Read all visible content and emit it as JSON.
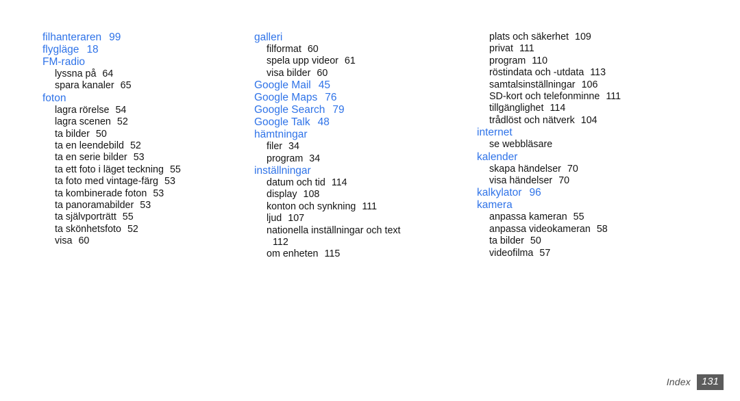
{
  "document": {
    "type": "index",
    "language": "sv",
    "background_color": "#ffffff",
    "heading_color": "#2f73e8",
    "body_color": "#131313",
    "footer_badge_color": "#5c5c5c"
  },
  "footer": {
    "label": "Index",
    "page_number": "131"
  },
  "columns": [
    {
      "id": "column-1",
      "groups": [
        {
          "heading": "filhanteraren",
          "heading_page": "99",
          "items": []
        },
        {
          "heading": "flygläge",
          "heading_page": "18",
          "items": []
        },
        {
          "heading": "FM-radio",
          "heading_page": "",
          "items": [
            {
              "label": "lyssna på",
              "page": "64"
            },
            {
              "label": "spara kanaler",
              "page": "65"
            }
          ]
        },
        {
          "heading": "foton",
          "heading_page": "",
          "items": [
            {
              "label": "lagra rörelse",
              "page": "54"
            },
            {
              "label": "lagra scenen",
              "page": "52"
            },
            {
              "label": "ta bilder",
              "page": "50"
            },
            {
              "label": "ta en leendebild",
              "page": "52"
            },
            {
              "label": "ta en serie bilder",
              "page": "53"
            },
            {
              "label": "ta ett foto i läget teckning",
              "page": "55"
            },
            {
              "label": "ta foto med vintage-färg",
              "page": "53"
            },
            {
              "label": "ta kombinerade foton",
              "page": "53"
            },
            {
              "label": "ta panoramabilder",
              "page": "53"
            },
            {
              "label": "ta självporträtt",
              "page": "55"
            },
            {
              "label": "ta skönhetsfoto",
              "page": "52"
            },
            {
              "label": "visa",
              "page": "60"
            }
          ]
        }
      ]
    },
    {
      "id": "column-2",
      "groups": [
        {
          "heading": "galleri",
          "heading_page": "",
          "items": [
            {
              "label": "filformat",
              "page": "60"
            },
            {
              "label": "spela upp videor",
              "page": "61"
            },
            {
              "label": "visa bilder",
              "page": "60"
            }
          ]
        },
        {
          "heading": "Google Mail",
          "heading_page": "45",
          "items": []
        },
        {
          "heading": "Google Maps",
          "heading_page": "76",
          "items": []
        },
        {
          "heading": "Google Search",
          "heading_page": "79",
          "items": []
        },
        {
          "heading": "Google Talk",
          "heading_page": "48",
          "items": []
        },
        {
          "heading": "hämtningar",
          "heading_page": "",
          "items": [
            {
              "label": "filer",
              "page": "34"
            },
            {
              "label": "program",
              "page": "34"
            }
          ]
        },
        {
          "heading": "inställningar",
          "heading_page": "",
          "items": [
            {
              "label": "datum och tid",
              "page": "114"
            },
            {
              "label": "display",
              "page": "108"
            },
            {
              "label": "konton och synkning",
              "page": "111"
            },
            {
              "label": "ljud",
              "page": "107"
            },
            {
              "label": "nationella inställningar och text",
              "page": "112",
              "wrap": true
            },
            {
              "label": "om enheten",
              "page": "115"
            }
          ]
        }
      ]
    },
    {
      "id": "column-3",
      "groups": [
        {
          "heading": "",
          "heading_page": "",
          "continuation": true,
          "items": [
            {
              "label": "plats och säkerhet",
              "page": "109"
            },
            {
              "label": "privat",
              "page": "111"
            },
            {
              "label": "program",
              "page": "110"
            },
            {
              "label": "röstindata och -utdata",
              "page": "113"
            },
            {
              "label": "samtalsinställningar",
              "page": "106"
            },
            {
              "label": "SD-kort och telefonminne",
              "page": "111"
            },
            {
              "label": "tillgänglighet",
              "page": "114"
            },
            {
              "label": "trådlöst och nätverk",
              "page": "104"
            }
          ]
        },
        {
          "heading": "internet",
          "heading_page": "",
          "items": [
            {
              "label": "se webbläsare",
              "page": ""
            }
          ]
        },
        {
          "heading": "kalender",
          "heading_page": "",
          "items": [
            {
              "label": "skapa händelser",
              "page": "70"
            },
            {
              "label": "visa händelser",
              "page": "70"
            }
          ]
        },
        {
          "heading": "kalkylator",
          "heading_page": "96",
          "items": []
        },
        {
          "heading": "kamera",
          "heading_page": "",
          "items": [
            {
              "label": "anpassa kameran",
              "page": "55"
            },
            {
              "label": "anpassa videokameran",
              "page": "58"
            },
            {
              "label": "ta bilder",
              "page": "50"
            },
            {
              "label": "videofilma",
              "page": "57"
            }
          ]
        }
      ]
    }
  ]
}
